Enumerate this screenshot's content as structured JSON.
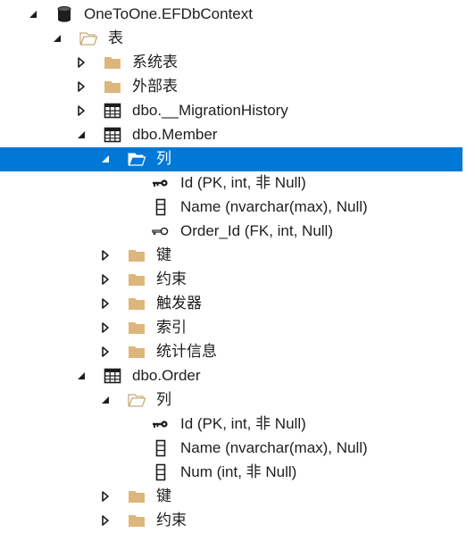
{
  "tree": {
    "root": {
      "label": "OneToOne.EFDbContext",
      "icon": "database-icon"
    },
    "tables_folder": {
      "label": "表"
    },
    "system_tables": {
      "label": "系统表"
    },
    "external_tables": {
      "label": "外部表"
    },
    "migration_history": {
      "label": "dbo.__MigrationHistory"
    },
    "member": {
      "label": "dbo.Member",
      "columns_folder": {
        "label": "列"
      },
      "columns": [
        {
          "label": "Id (PK, int, 非 Null)",
          "icon": "primary-key-icon"
        },
        {
          "label": "Name (nvarchar(max), Null)",
          "icon": "column-icon"
        },
        {
          "label": "Order_Id (FK, int, Null)",
          "icon": "foreign-key-icon"
        }
      ],
      "keys": {
        "label": "键"
      },
      "constraints": {
        "label": "约束"
      },
      "triggers": {
        "label": "触发器"
      },
      "indexes": {
        "label": "索引"
      },
      "statistics": {
        "label": "统计信息"
      }
    },
    "order": {
      "label": "dbo.Order",
      "columns_folder": {
        "label": "列"
      },
      "columns": [
        {
          "label": "Id (PK, int, 非 Null)",
          "icon": "primary-key-icon"
        },
        {
          "label": "Name (nvarchar(max), Null)",
          "icon": "column-icon"
        },
        {
          "label": "Num (int, 非 Null)",
          "icon": "column-icon"
        }
      ],
      "keys": {
        "label": "键"
      },
      "constraints": {
        "label": "约束"
      }
    }
  },
  "colors": {
    "selection": "#0078d7",
    "folder": "#dcb67a",
    "text": "#1e1e1e"
  }
}
